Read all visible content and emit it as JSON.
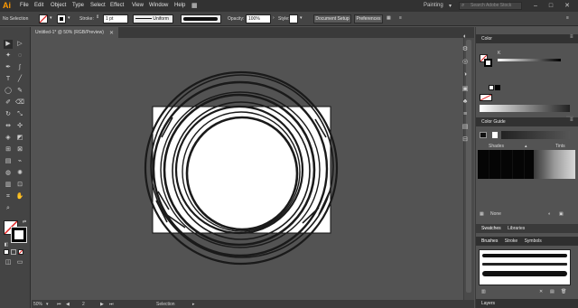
{
  "app": {
    "logo": "Ai",
    "menu": [
      "File",
      "Edit",
      "Object",
      "Type",
      "Select",
      "Effect",
      "View",
      "Window",
      "Help"
    ],
    "workspace": "Painting",
    "search_placeholder": "Search Adobe Stock"
  },
  "control_bar": {
    "selection_label": "No Selection",
    "stroke_label": "Stroke:",
    "stroke_weight": "1 pt",
    "stroke_profile": "Uniform",
    "opacity_label": "Opacity:",
    "opacity_value": "100%",
    "style_label": "Style:",
    "document_setup": "Document Setup",
    "preferences": "Preferences"
  },
  "document": {
    "tab_title": "Untitled-1* @ 50% (RGB/Preview)",
    "zoom": "50%",
    "artboard_number": "2",
    "status_tool": "Selection"
  },
  "panels": {
    "color": {
      "title": "Color",
      "channel": "K",
      "colors": {
        "fill": "#ffffff",
        "stroke": "#000000",
        "none_red": "#e02020"
      }
    },
    "color_guide": {
      "title": "Color Guide",
      "shades_label": "Shades",
      "tints_label": "Tints",
      "footer_label": "None"
    },
    "tabs": [
      "Swatches",
      "Libraries"
    ],
    "brush_tabs": [
      "Brushes",
      "Stroke",
      "Symbols"
    ],
    "layers": {
      "title": "Layers"
    }
  },
  "theme": {
    "ui_bg": "#535353",
    "panel_dark": "#323232",
    "accent": "#ff9a00"
  }
}
